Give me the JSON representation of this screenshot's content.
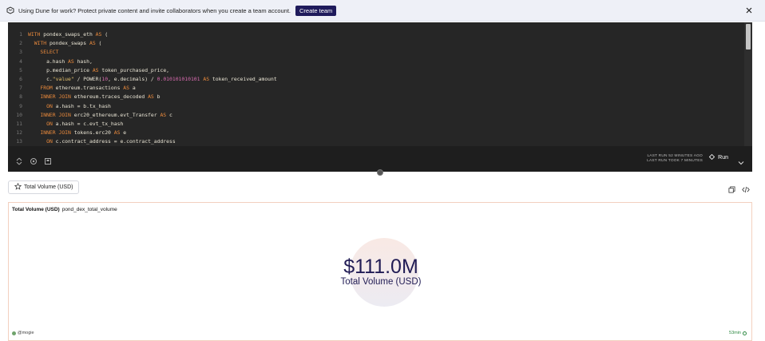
{
  "banner": {
    "message": "Using Dune for work? Protect private content and invite collaborators when you create a team account.",
    "create_team_label": "Create team"
  },
  "editor": {
    "lines": [
      {
        "n": "1",
        "html": "<span class=\"kw\">WITH</span> pondex_swaps_eth <span class=\"kw\">AS</span> ("
      },
      {
        "n": "2",
        "html": "  <span class=\"kw\">WITH</span> pondex_swaps <span class=\"kw\">AS</span> ("
      },
      {
        "n": "3",
        "html": "    <span class=\"kw\">SELECT</span>"
      },
      {
        "n": "4",
        "html": "      a.hash <span class=\"kw\">AS</span> hash,"
      },
      {
        "n": "5",
        "html": "      p.median_price <span class=\"kw\">AS</span> token_purchased_price,"
      },
      {
        "n": "6",
        "html": "      c.<span class=\"str\">\"value\"</span> / POWER(<span class=\"num\">10</span>, e.decimals) / <span class=\"num\">0.010101010101</span> <span class=\"kw\">AS</span> token_received_amount"
      },
      {
        "n": "7",
        "html": "    <span class=\"kw\">FROM</span> ethereum.transactions <span class=\"kw\">AS</span> a"
      },
      {
        "n": "8",
        "html": "    <span class=\"kw\">INNER JOIN</span> ethereum.traces_decoded <span class=\"kw\">AS</span> b"
      },
      {
        "n": "9",
        "html": "      <span class=\"kw\">ON</span> a.hash = b.tx_hash"
      },
      {
        "n": "10",
        "html": "    <span class=\"kw\">INNER JOIN</span> erc20_ethereum.evt_Transfer <span class=\"kw\">AS</span> c"
      },
      {
        "n": "11",
        "html": "      <span class=\"kw\">ON</span> a.hash = c.evt_tx_hash"
      },
      {
        "n": "12",
        "html": "    <span class=\"kw\">INNER JOIN</span> tokens.erc20 <span class=\"kw\">AS</span> e"
      },
      {
        "n": "13",
        "html": "      <span class=\"kw\">ON</span> c.contract_address = e.contract_address"
      }
    ]
  },
  "toolbar": {
    "last_run_1": "LAST RUN 52 MINUTES AGO",
    "last_run_2": "LAST RUN TOOK 7 MINUTES",
    "run_label": "Run"
  },
  "visual_tab": {
    "label": "Total Volume (USD)"
  },
  "counter": {
    "title": "Total Volume (USD)",
    "subtitle": "pond_dex_total_volume",
    "value": "$111.0M",
    "label": "Total Volume (USD)",
    "author": "@mogie",
    "age": "53min"
  },
  "colors": {
    "accent": "#1f1b5c",
    "editor_bg": "#262626",
    "keyword": "#ea8a3c",
    "number": "#d96bb0",
    "fresh": "#2f8a44"
  }
}
